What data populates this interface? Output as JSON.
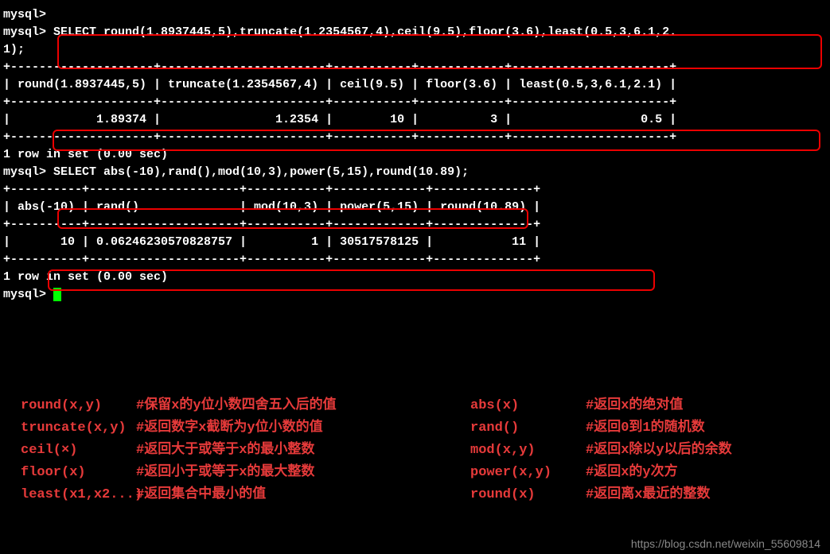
{
  "terminal": {
    "prompt1": "mysql>",
    "prompt2": "mysql> ",
    "query1_a": "SELECT round(1.8937445,5),truncate(1.2354567,4),ceil(9.5),floor(3.6),least(0.5,3,6.1,2.",
    "query1_b": "1);",
    "sep1": "+--------------------+-----------------------+-----------+------------+----------------------+",
    "head1": "| round(1.8937445,5) | truncate(1.2354567,4) | ceil(9.5) | floor(3.6) | least(0.5,3,6.1,2.1) |",
    "row1": "|            1.89374 |                1.2354 |        10 |          3 |                  0.5 |",
    "rowset1": "1 row in set (0.00 sec)",
    "blank": "",
    "query2": "SELECT abs(-10),rand(),mod(10,3),power(5,15),round(10.89);",
    "sep2": "+----------+---------------------+-----------+-------------+--------------+",
    "head2": "| abs(-10) | rand()              | mod(10,3) | power(5,15) | round(10.89) |",
    "row2": "|       10 | 0.06246230570828757 |         1 | 30517578125 |           11 |",
    "rowset2": "1 row in set (0.00 sec)"
  },
  "annotations_left": [
    {
      "func": "round(x,y)",
      "desc": "#保留x的y位小数四舍五入后的值"
    },
    {
      "func": "truncate(x,y)",
      "desc": "#返回数字x截断为y位小数的值"
    },
    {
      "func": "ceil(×)",
      "desc": "#返回大于或等于x的最小整数"
    },
    {
      "func": "floor(x)",
      "desc": "#返回小于或等于x的最大整数"
    },
    {
      "func": "least(x1,x2...)",
      "desc": "#返回集合中最小的值"
    }
  ],
  "annotations_right": [
    {
      "func": "abs(x)",
      "desc": "#返回x的绝对值"
    },
    {
      "func": "rand()",
      "desc": "#返回0到1的随机数"
    },
    {
      "func": "mod(x,y)",
      "desc": "#返回x除以y以后的余数"
    },
    {
      "func": "power(x,y)",
      "desc": "#返回x的y次方"
    },
    {
      "func": "round(x)",
      "desc": "#返回离x最近的整数"
    }
  ],
  "watermark": "https://blog.csdn.net/weixin_55609814"
}
